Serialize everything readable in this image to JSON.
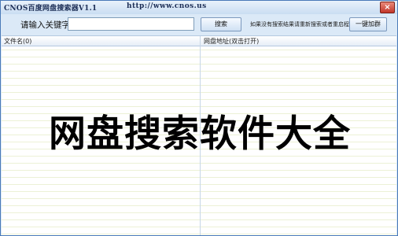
{
  "window": {
    "title": "CNOS百度网盘搜索器V1.1",
    "url": "http://www.cnos.us",
    "close_icon": "×"
  },
  "toolbar": {
    "keyword_label": "请输入关键字:",
    "keyword_value": "",
    "search_label": "搜索",
    "hint": "如果没有搜索结果请重新搜索或者重启程序",
    "accelerate_label": "一键加群"
  },
  "list": {
    "columns": [
      "文件名(0)",
      "网盘地址(双击打开)"
    ],
    "rows": []
  },
  "overlay_text": "网盘搜索软件大全",
  "colors": {
    "titlebar": "#c9ddf2",
    "toolbar": "#dbe9f7",
    "close": "#c2362a",
    "row_line": "#ecf1d6"
  }
}
